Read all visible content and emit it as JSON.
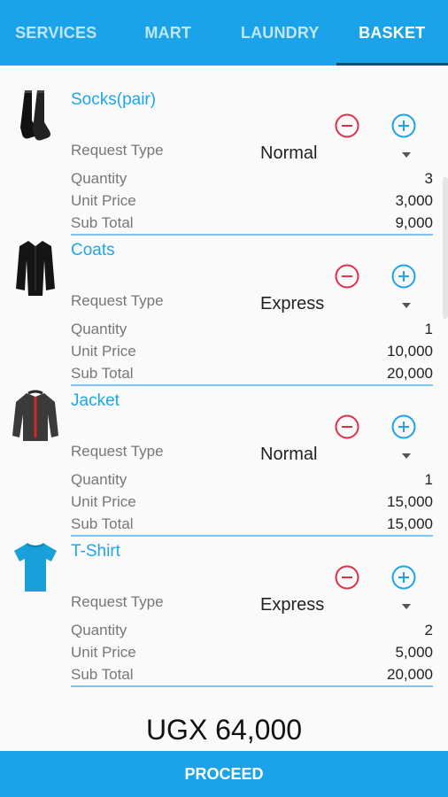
{
  "tabs": [
    {
      "label": "SERVICES",
      "active": false
    },
    {
      "label": "MART",
      "active": false
    },
    {
      "label": "LAUNDRY",
      "active": false
    },
    {
      "label": "BASKET",
      "active": true
    }
  ],
  "labels": {
    "request_type": "Request Type",
    "quantity": "Quantity",
    "unit_price": "Unit Price",
    "sub_total": "Sub Total"
  },
  "items": [
    {
      "name": "Socks(pair)",
      "icon": "socks-icon",
      "request_type": "Normal",
      "quantity": "3",
      "unit_price": "3,000",
      "sub_total": "9,000"
    },
    {
      "name": "Coats",
      "icon": "coat-icon",
      "request_type": "Express",
      "quantity": "1",
      "unit_price": "10,000",
      "sub_total": "20,000"
    },
    {
      "name": "Jacket",
      "icon": "jacket-icon",
      "request_type": "Normal",
      "quantity": "1",
      "unit_price": "15,000",
      "sub_total": "15,000"
    },
    {
      "name": "T-Shirt",
      "icon": "tshirt-icon",
      "request_type": "Express",
      "quantity": "2",
      "unit_price": "5,000",
      "sub_total": "20,000"
    }
  ],
  "total": "UGX 64,000",
  "proceed_label": "PROCEED",
  "colors": {
    "accent": "#1aa3e8",
    "minus": "#e0304a",
    "plus": "#1aa3e8"
  }
}
